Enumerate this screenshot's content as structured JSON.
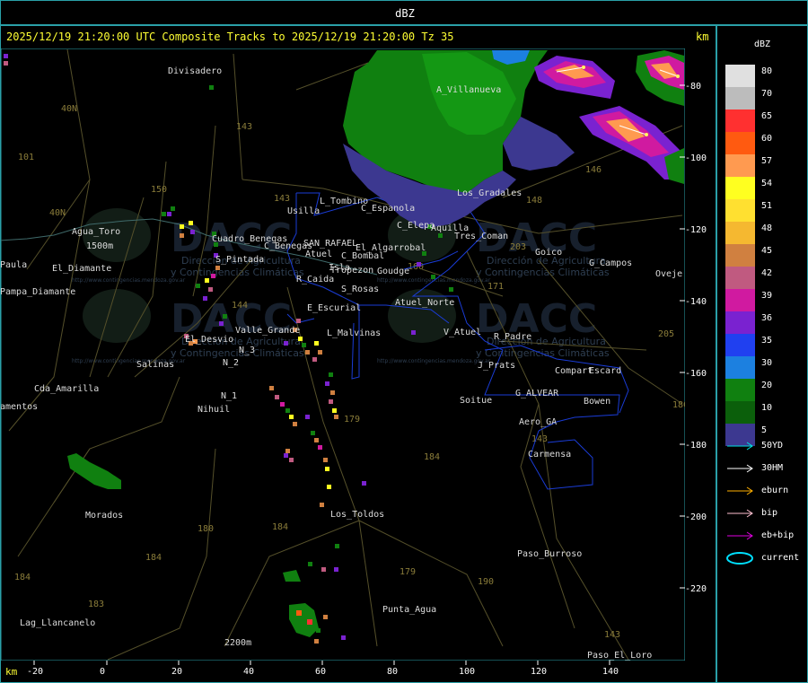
{
  "window": {
    "title": "dBZ"
  },
  "header": {
    "text": "2025/12/19 21:20:00 UTC Composite Tracks to 2025/12/19 21:20:00 Tz 35"
  },
  "axis": {
    "unit": "km",
    "x_ticks": [
      "-20",
      "0",
      "20",
      "40",
      "60",
      "80",
      "100",
      "120",
      "140"
    ],
    "y_ticks": [
      "-80",
      "-100",
      "-120",
      "-140",
      "-160",
      "-180",
      "-200",
      "-220"
    ]
  },
  "places": [
    "Divisadero",
    "A_Villanueva",
    "Usilla",
    "L_Tombino",
    "C_Espanola",
    "C_Elepa",
    "Aquilla",
    "Los_Gradales",
    "Tres_Coman",
    "Agua_Toro",
    "Cuadro_Benegas",
    "C_Benegas",
    "SAN_RAFAEL",
    "Atuel",
    "El_Algarrobal",
    "C_Bombal",
    "Goudge",
    "S_Pintada",
    "Isla",
    "Tropezon",
    "Goico",
    "G_Campos",
    "Oveje",
    "Paula",
    "El_Diamante",
    "Pampa_Diamante",
    "R_Caida",
    "S_Rosas",
    "Atuel_Norte",
    "E_Escurial",
    "L_Malvinas",
    "V_Atuel",
    "R_Padre",
    "Valle_Grande",
    "El_Desvio",
    "N_2",
    "N_3",
    "Salinas",
    "J_Prats",
    "Compart",
    "Escard",
    "Cda_Amarilla",
    "N_1",
    "Nihuil",
    "Soitue",
    "G_ALVEAR",
    "Bowen",
    "Aero_GA",
    "amentos",
    "Carmensa",
    "Morados",
    "Los_Toldos",
    "Paso_Burroso",
    "Punta_Agua",
    "Lag_Llancanelo",
    "Paso_El_Loro",
    "1500m",
    "2200m"
  ],
  "legend": {
    "title": "dBZ",
    "scale": [
      {
        "value": "80",
        "color": "#e0e0e0"
      },
      {
        "value": "70",
        "color": "#bcbcbc"
      },
      {
        "value": "65",
        "color": "#ff3030"
      },
      {
        "value": "60",
        "color": "#ff5a10"
      },
      {
        "value": "57",
        "color": "#ff9a50"
      },
      {
        "value": "54",
        "color": "#ffff20"
      },
      {
        "value": "51",
        "color": "#ffe030"
      },
      {
        "value": "48",
        "color": "#f5b830"
      },
      {
        "value": "45",
        "color": "#d08040"
      },
      {
        "value": "42",
        "color": "#c05a80"
      },
      {
        "value": "39",
        "color": "#d01aa0"
      },
      {
        "value": "36",
        "color": "#7a22d0"
      },
      {
        "value": "35",
        "color": "#2040f0"
      },
      {
        "value": "30",
        "color": "#1c80e0"
      },
      {
        "value": "20",
        "color": "#108010"
      },
      {
        "value": "10",
        "color": "#0b5f0b"
      },
      {
        "value": "5",
        "color": "#3c3890"
      }
    ],
    "tracks": [
      {
        "label": "50YD",
        "color": "#00e0e0"
      },
      {
        "label": "30HM",
        "color": "#ffffff"
      },
      {
        "label": "eburn",
        "color": "#ffb000"
      },
      {
        "label": "bip",
        "color": "#ffc0d0"
      },
      {
        "label": "eb+bip",
        "color": "#e000e0"
      },
      {
        "label": "current",
        "color": "#00e0ff"
      }
    ]
  },
  "watermark": {
    "brand": "DACC",
    "line1": "Dirección de Agricultura",
    "line2": "y Contingencias Climáticas",
    "url": "http://www.contingencias.mendoza.gov.ar"
  }
}
